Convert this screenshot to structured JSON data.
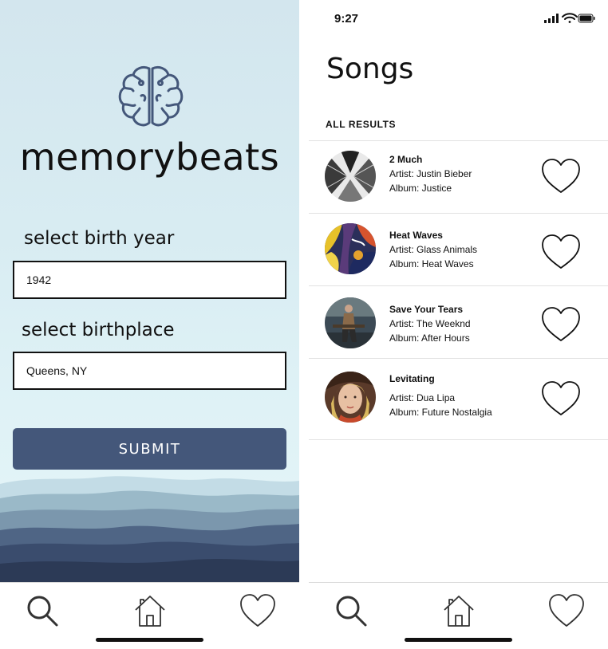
{
  "login": {
    "brand": "memorybeats",
    "birth_year_label": "select birth year",
    "birth_year_value": "1942",
    "birthplace_label": "select birthplace",
    "birthplace_value": "Queens, NY",
    "submit_label": "SUBMIT"
  },
  "tabbar": {
    "icons": [
      "search-icon",
      "home-icon",
      "heart-icon"
    ]
  },
  "songs_screen": {
    "status_time": "9:27",
    "title": "Songs",
    "section_label": "ALL RESULTS",
    "songs": [
      {
        "title": "2 Much",
        "artist": "Artist: Justin Bieber",
        "album": "Album: Justice"
      },
      {
        "title": "Heat Waves",
        "artist": "Artist: Glass Animals",
        "album": "Album: Heat Waves"
      },
      {
        "title": "Save Your Tears",
        "artist": "Artist: The Weeknd",
        "album": "Album: After Hours"
      },
      {
        "title": "Levitating",
        "artist": "Artist: Dua Lipa",
        "album": "Album: Future Nostalgia"
      }
    ]
  },
  "colors": {
    "accent": "#44577a",
    "brain_icon": "#44577a",
    "sky": "#d8ecf2"
  }
}
